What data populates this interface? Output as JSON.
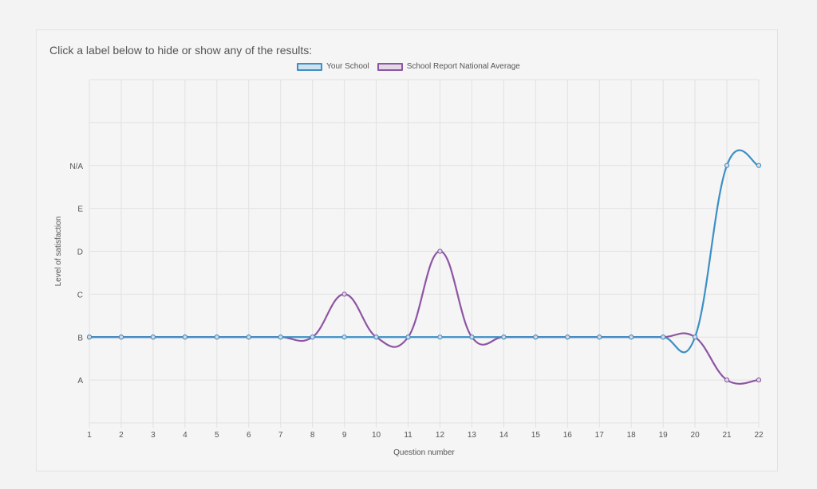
{
  "instruction": "Click a label below to hide or show any of the results:",
  "legend": [
    {
      "label": "Your School",
      "color": "#3d8fc4",
      "fill": "#cfe0ee"
    },
    {
      "label": "School Report National Average",
      "color": "#8e55a2",
      "fill": "#e2d9e6"
    }
  ],
  "chart_data": {
    "type": "line",
    "title": "",
    "xlabel": "Question number",
    "ylabel": "Level of satisfaction",
    "x": [
      1,
      2,
      3,
      4,
      5,
      6,
      7,
      8,
      9,
      10,
      11,
      12,
      13,
      14,
      15,
      16,
      17,
      18,
      19,
      20,
      21,
      22
    ],
    "ycategories": [
      "A",
      "B",
      "C",
      "D",
      "E",
      "N/A"
    ],
    "series": [
      {
        "name": "Your School",
        "color": "#3d8fc4",
        "values": [
          "B",
          "B",
          "B",
          "B",
          "B",
          "B",
          "B",
          "B",
          "B",
          "B",
          "B",
          "B",
          "B",
          "B",
          "B",
          "B",
          "B",
          "B",
          "B",
          "B",
          "N/A",
          "N/A"
        ]
      },
      {
        "name": "School Report National Average",
        "color": "#8e55a2",
        "values": [
          "B",
          "B",
          "B",
          "B",
          "B",
          "B",
          "B",
          "B",
          "C",
          "B",
          "B",
          "D",
          "B",
          "B",
          "B",
          "B",
          "B",
          "B",
          "B",
          "B",
          "A",
          "A"
        ]
      }
    ],
    "grid": true,
    "legend_position": "top"
  }
}
